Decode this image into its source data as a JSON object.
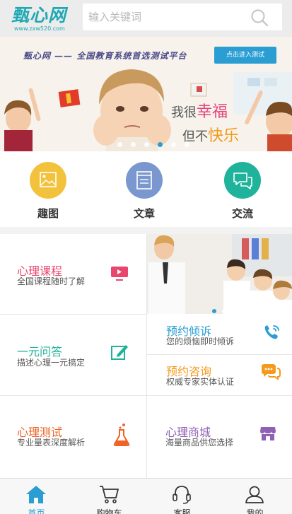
{
  "header": {
    "logo_text": "甄心网",
    "logo_url": "www.zxw520.com",
    "search_placeholder": "输入关键词"
  },
  "banner": {
    "title": "甄心网 —— 全国教育系统首选测试平台",
    "button_label": "点击进入测试",
    "slogan": [
      "我很",
      "幸福",
      "但不",
      "快乐"
    ],
    "slide_count": 6,
    "active_slide": 3
  },
  "categories": [
    {
      "label": "趣图",
      "color": "#f3c23c",
      "icon": "picture-icon"
    },
    {
      "label": "文章",
      "color": "#7b97cf",
      "icon": "article-icon"
    },
    {
      "label": "交流",
      "color": "#1eb39a",
      "icon": "chat-icon"
    }
  ],
  "services": {
    "course": {
      "title": "心理课程",
      "subtitle": "全国课程随时了解",
      "color": "#e8466c",
      "icon": "tv-icon"
    },
    "ask": {
      "title": "一元问答",
      "subtitle": "描述心理一元搞定",
      "color": "#1eb39a",
      "icon": "edit-icon"
    },
    "complain": {
      "title": "预约倾诉",
      "subtitle": "您的烦恼即时倾诉",
      "color": "#2a9ed3",
      "icon": "phone-icon"
    },
    "consult": {
      "title": "预约咨询",
      "subtitle": "权威专家实体认证",
      "color": "#f39a1e",
      "icon": "consult-chat-icon"
    },
    "test": {
      "title": "心理测试",
      "subtitle": "专业量表深度解析",
      "color": "#f06226",
      "icon": "flask-icon"
    },
    "shop": {
      "title": "心理商城",
      "subtitle": "海量商品供您选择",
      "color": "#9061b3",
      "icon": "store-icon"
    }
  },
  "photo_carousel": {
    "slide_count": 3,
    "active_slide": 0
  },
  "tabbar": {
    "items": [
      {
        "label": "首页",
        "icon": "home-icon",
        "active": true
      },
      {
        "label": "购物车",
        "icon": "cart-icon",
        "active": false
      },
      {
        "label": "客服",
        "icon": "headset-icon",
        "active": false
      },
      {
        "label": "我的",
        "icon": "user-icon",
        "active": false
      }
    ],
    "active_color": "#2a9ed3"
  }
}
